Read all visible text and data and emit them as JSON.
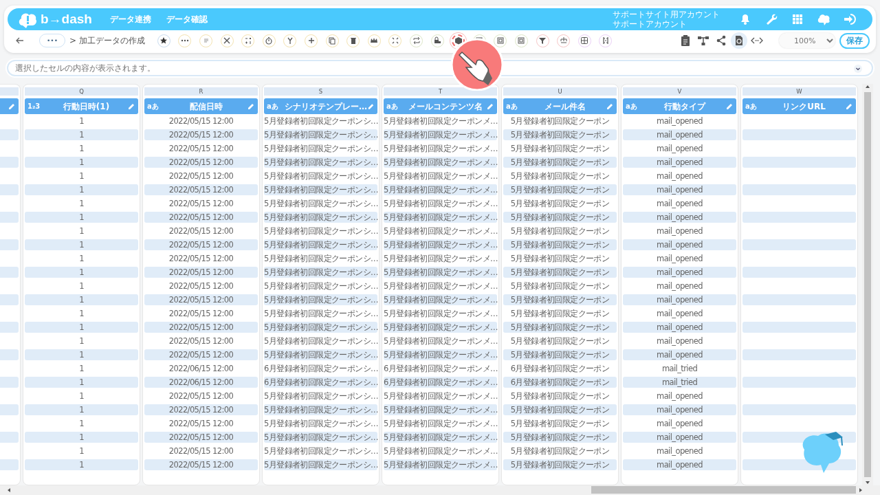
{
  "header": {
    "logo": "b→dash",
    "nav": [
      "データ連携",
      "データ確認"
    ],
    "account": [
      "サポートサイト用アカウント",
      "サポートアカウント"
    ]
  },
  "toolbar": {
    "breadcrumb_more": "•••",
    "breadcrumb": "> 加工データの作成",
    "tools": [
      {
        "kind": "star",
        "highlighted": false,
        "color": "#c9dcef"
      },
      {
        "kind": "dots",
        "highlighted": false,
        "color": "#f3e2b0"
      },
      {
        "kind": "lines",
        "highlighted": false,
        "color": "#f3e2b0"
      },
      {
        "kind": "scissors",
        "highlighted": false,
        "color": "#f3e2b0"
      },
      {
        "kind": "calc",
        "highlighted": false,
        "color": "#f3e2b0"
      },
      {
        "kind": "timer",
        "highlighted": false,
        "color": "#f3e2b0"
      },
      {
        "kind": "fork",
        "highlighted": false,
        "color": "#f3e2b0"
      },
      {
        "kind": "plus",
        "highlighted": false,
        "color": "#f3e2b0"
      },
      {
        "kind": "copy",
        "highlighted": false,
        "color": "#f3e2b0"
      },
      {
        "kind": "trash",
        "highlighted": false,
        "color": "#f3e2b0"
      },
      {
        "kind": "crown",
        "highlighted": false,
        "color": "#f3e2b0"
      },
      {
        "kind": "compress",
        "highlighted": false,
        "color": "#f3e2b0"
      },
      {
        "kind": "repeat",
        "highlighted": false,
        "color": "#dde6c8"
      },
      {
        "kind": "lock",
        "highlighted": false,
        "color": "#dde6c8"
      },
      {
        "kind": "box",
        "highlighted": true
      },
      {
        "kind": "square",
        "highlighted": false,
        "color": "#dde6c8"
      },
      {
        "kind": "square",
        "highlighted": false,
        "color": "#dde6c8"
      },
      {
        "kind": "square",
        "highlighted": false,
        "color": "#dde6c8"
      },
      {
        "kind": "filter",
        "highlighted": false,
        "color": "#f6c6c6"
      },
      {
        "kind": "tree",
        "highlighted": false,
        "color": "#f6c6c6"
      },
      {
        "kind": "grid",
        "highlighted": false,
        "color": "#ead0f6"
      },
      {
        "kind": "bracket",
        "highlighted": false,
        "color": "#ead0f6"
      }
    ],
    "right_tools": [
      {
        "kind": "clipboard",
        "selected": false
      },
      {
        "kind": "network",
        "selected": false
      },
      {
        "kind": "share",
        "selected": false
      },
      {
        "kind": "refresh",
        "selected": true
      },
      {
        "kind": "code",
        "selected": false
      }
    ],
    "zoom": "100%",
    "save": "保存"
  },
  "formula_bar": {
    "placeholder": "選択したセルの内容が表示されます。"
  },
  "table": {
    "left_column_cut": true,
    "columns": [
      {
        "kind": "full",
        "letter": "Q",
        "type_badge": "1₂3",
        "title": "行動日時(1)"
      },
      {
        "kind": "full",
        "letter": "R",
        "type_badge": "aあ",
        "title": "配信日時"
      },
      {
        "kind": "full",
        "letter": "S",
        "type_badge": "aあ",
        "title": "シナリオテンプレー…"
      },
      {
        "kind": "full",
        "letter": "T",
        "type_badge": "aあ",
        "title": "メールコンテンツ名"
      },
      {
        "kind": "full",
        "letter": "U",
        "type_badge": "aあ",
        "title": "メール件名"
      },
      {
        "kind": "full",
        "letter": "V",
        "type_badge": "aあ",
        "title": "行動タイプ"
      },
      {
        "kind": "full",
        "letter": "W",
        "type_badge": "aあ",
        "title": "リンクURL"
      }
    ],
    "rows": [
      {
        "cells": [
          "1",
          "2022/05/15 12:00",
          "5月登録者初回限定クーポンシ…",
          "5月登録者初回限定クーポンメ…",
          "5月登録者初回限定クーポン",
          "mail_opened"
        ]
      },
      {
        "cells": [
          "1",
          "2022/05/15 12:00",
          "5月登録者初回限定クーポンシ…",
          "5月登録者初回限定クーポンメ…",
          "5月登録者初回限定クーポン",
          "mail_opened"
        ]
      },
      {
        "cells": [
          "1",
          "2022/05/15 12:00",
          "5月登録者初回限定クーポンシ…",
          "5月登録者初回限定クーポンメ…",
          "5月登録者初回限定クーポン",
          "mail_opened"
        ]
      },
      {
        "cells": [
          "1",
          "2022/05/15 12:00",
          "5月登録者初回限定クーポンシ…",
          "5月登録者初回限定クーポンメ…",
          "5月登録者初回限定クーポン",
          "mail_opened"
        ]
      },
      {
        "cells": [
          "1",
          "2022/05/15 12:00",
          "5月登録者初回限定クーポンシ…",
          "5月登録者初回限定クーポンメ…",
          "5月登録者初回限定クーポン",
          "mail_opened"
        ]
      },
      {
        "cells": [
          "1",
          "2022/05/15 12:00",
          "5月登録者初回限定クーポンシ…",
          "5月登録者初回限定クーポンメ…",
          "5月登録者初回限定クーポン",
          "mail_opened"
        ]
      },
      {
        "cells": [
          "1",
          "2022/05/15 12:00",
          "5月登録者初回限定クーポンシ…",
          "5月登録者初回限定クーポンメ…",
          "5月登録者初回限定クーポン",
          "mail_opened"
        ]
      },
      {
        "cells": [
          "1",
          "2022/05/15 12:00",
          "5月登録者初回限定クーポンシ…",
          "5月登録者初回限定クーポンメ…",
          "5月登録者初回限定クーポン",
          "mail_opened"
        ]
      },
      {
        "cells": [
          "1",
          "2022/05/15 12:00",
          "5月登録者初回限定クーポンシ…",
          "5月登録者初回限定クーポンメ…",
          "5月登録者初回限定クーポン",
          "mail_opened"
        ]
      },
      {
        "cells": [
          "1",
          "2022/05/15 12:00",
          "5月登録者初回限定クーポンシ…",
          "5月登録者初回限定クーポンメ…",
          "5月登録者初回限定クーポン",
          "mail_opened"
        ]
      },
      {
        "cells": [
          "1",
          "2022/05/15 12:00",
          "5月登録者初回限定クーポンシ…",
          "5月登録者初回限定クーポンメ…",
          "5月登録者初回限定クーポン",
          "mail_opened"
        ]
      },
      {
        "cells": [
          "1",
          "2022/05/15 12:00",
          "5月登録者初回限定クーポンシ…",
          "5月登録者初回限定クーポンメ…",
          "5月登録者初回限定クーポン",
          "mail_opened"
        ]
      },
      {
        "cells": [
          "1",
          "2022/05/15 12:00",
          "5月登録者初回限定クーポンシ…",
          "5月登録者初回限定クーポンメ…",
          "5月登録者初回限定クーポン",
          "mail_opened"
        ]
      },
      {
        "cells": [
          "1",
          "2022/05/15 12:00",
          "5月登録者初回限定クーポンシ…",
          "5月登録者初回限定クーポンメ…",
          "5月登録者初回限定クーポン",
          "mail_opened"
        ]
      },
      {
        "cells": [
          "1",
          "2022/05/15 12:00",
          "5月登録者初回限定クーポンシ…",
          "5月登録者初回限定クーポンメ…",
          "5月登録者初回限定クーポン",
          "mail_opened"
        ]
      },
      {
        "cells": [
          "1",
          "2022/05/15 12:00",
          "5月登録者初回限定クーポンシ…",
          "5月登録者初回限定クーポンメ…",
          "5月登録者初回限定クーポン",
          "mail_opened"
        ]
      },
      {
        "cells": [
          "1",
          "2022/05/15 12:00",
          "5月登録者初回限定クーポンシ…",
          "5月登録者初回限定クーポンメ…",
          "5月登録者初回限定クーポン",
          "mail_opened"
        ]
      },
      {
        "cells": [
          "1",
          "2022/05/15 12:00",
          "5月登録者初回限定クーポンシ…",
          "5月登録者初回限定クーポンメ…",
          "5月登録者初回限定クーポン",
          "mail_opened"
        ]
      },
      {
        "cells": [
          "1",
          "2022/06/15 12:00",
          "6月登録者初回限定クーポンシ…",
          "6月登録者初回限定クーポンメ…",
          "6月登録者初回限定クーポン",
          "mail_tried"
        ]
      },
      {
        "cells": [
          "1",
          "2022/06/15 12:00",
          "6月登録者初回限定クーポンシ…",
          "6月登録者初回限定クーポンメ…",
          "6月登録者初回限定クーポン",
          "mail_tried"
        ]
      },
      {
        "cells": [
          "1",
          "2022/05/15 12:00",
          "5月登録者初回限定クーポンシ…",
          "5月登録者初回限定クーポンメ…",
          "5月登録者初回限定クーポン",
          "mail_opened"
        ]
      },
      {
        "cells": [
          "1",
          "2022/05/15 12:00",
          "5月登録者初回限定クーポンシ…",
          "5月登録者初回限定クーポンメ…",
          "5月登録者初回限定クーポン",
          "mail_opened"
        ]
      },
      {
        "cells": [
          "1",
          "2022/05/15 12:00",
          "5月登録者初回限定クーポンシ…",
          "5月登録者初回限定クーポンメ…",
          "5月登録者初回限定クーポン",
          "mail_opened"
        ]
      },
      {
        "cells": [
          "1",
          "2022/05/15 12:00",
          "5月登録者初回限定クーポンシ…",
          "5月登録者初回限定クーポンメ…",
          "5月登録者初回限定クーポン",
          "mail_opened"
        ]
      },
      {
        "cells": [
          "1",
          "2022/05/15 12:00",
          "5月登録者初回限定クーポンシ…",
          "5月登録者初回限定クーポンメ…",
          "5月登録者初回限定クーポン",
          "mail_opened"
        ]
      },
      {
        "cells": [
          "1",
          "2022/05/15 12:00",
          "5月登録者初回限定クーポンシ…",
          "5月登録者初回限定クーポンメ…",
          "5月登録者初回限定クーポン",
          "mail_opened"
        ]
      }
    ]
  }
}
